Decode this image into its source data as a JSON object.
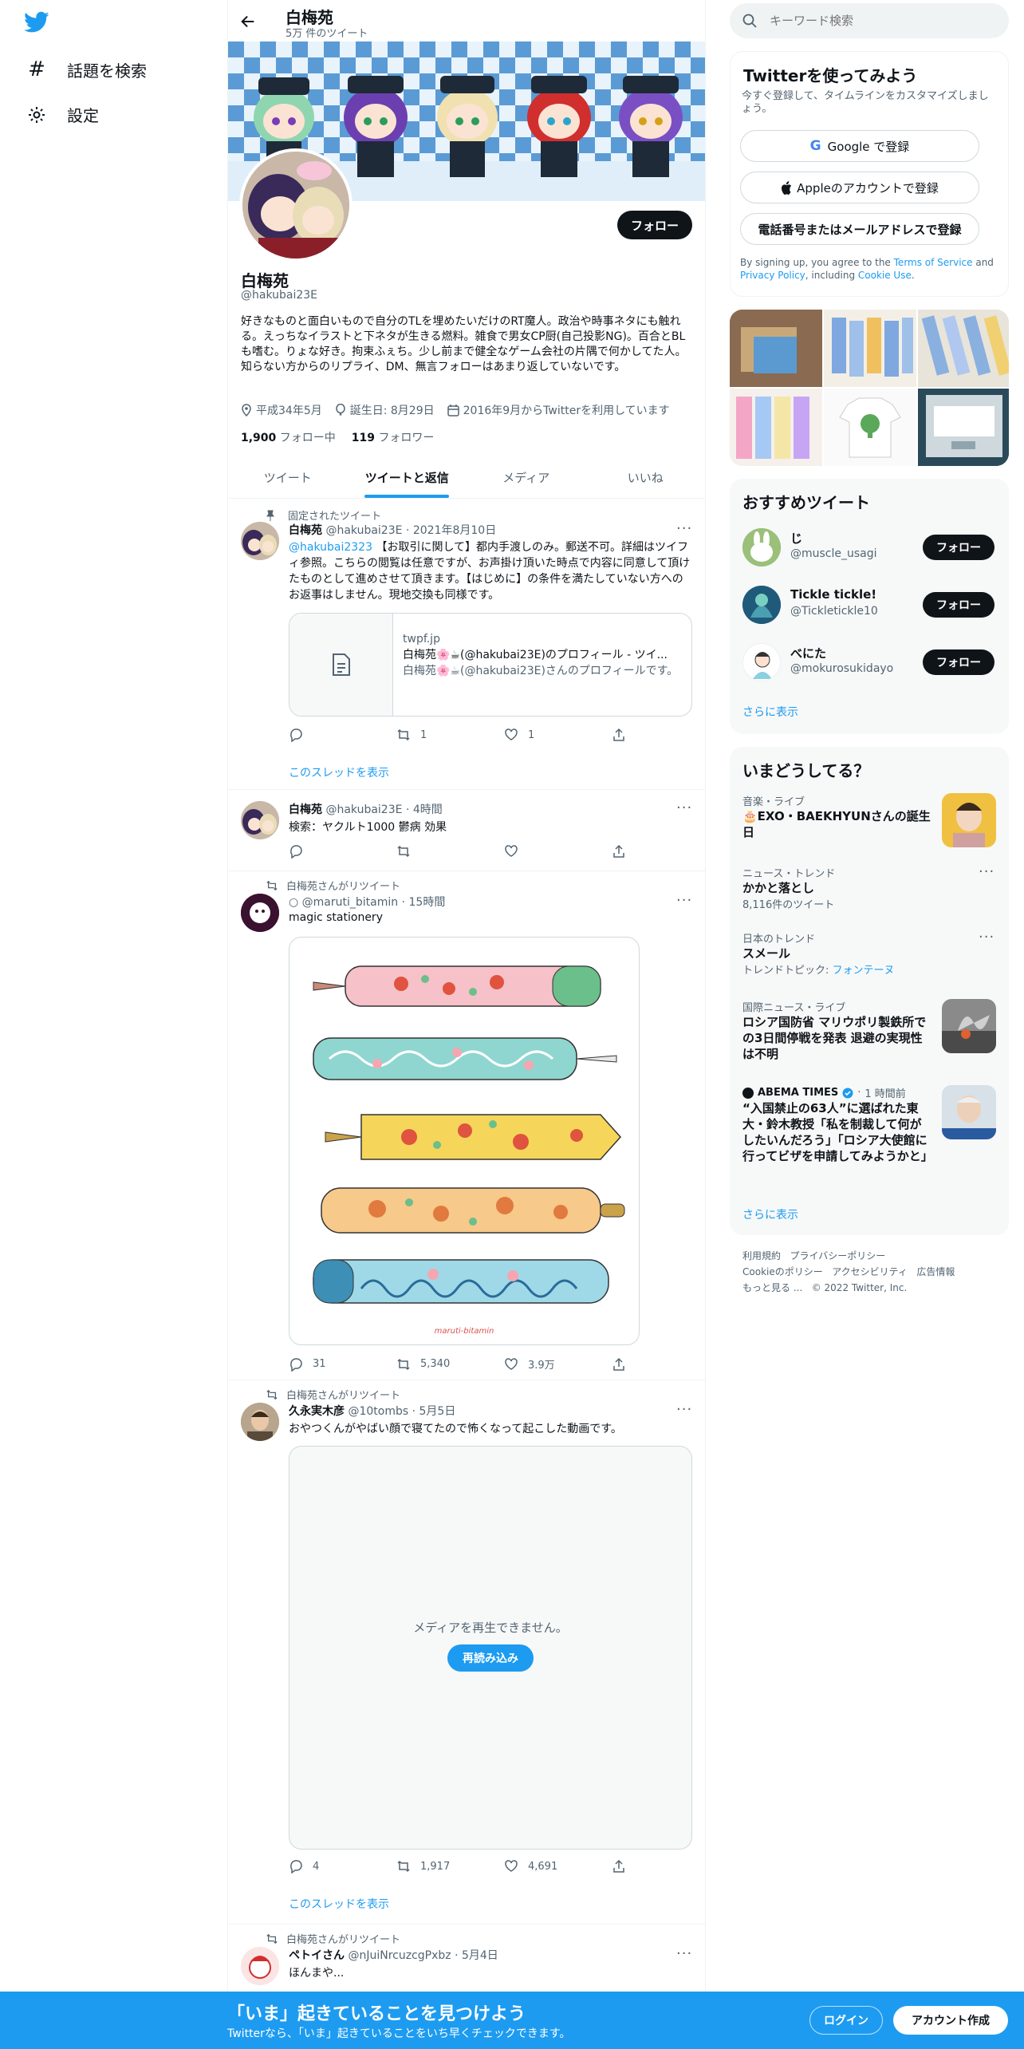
{
  "nav": {
    "explore_label": "話題を検索",
    "settings_label": "設定"
  },
  "header": {
    "name": "白梅苑",
    "tweet_count": "5万 件のツイート"
  },
  "profile": {
    "name": "白梅苑",
    "handle": "@hakubai23E",
    "follow_label": "フォロー",
    "bio": "好きなものと面白いもので自分のTLを埋めたいだけのRT魔人。政治や時事ネタにも触れる。えっちなイラストと下ネタが生きる燃料。雑食で男女CP厨(自己投影NG)。百合とBLも嗜む。りょな好き。拘束ふぇち。少し前まで健全なゲーム会社の片隅で何かしてた人。知らない方からのリプライ、DM、無言フォローはあまり返していないです。",
    "location": "平成34年5月",
    "birthday": "誕生日: 8月29日",
    "joined": "2016年9月からTwitterを利用しています",
    "following_count": "1,900",
    "following_label": "フォロー中",
    "followers_count": "119",
    "followers_label": "フォロワー"
  },
  "tabs": [
    {
      "label": "ツイート",
      "active": false
    },
    {
      "label": "ツイートと返信",
      "active": true
    },
    {
      "label": "メディア",
      "active": false
    },
    {
      "label": "いいね",
      "active": false
    }
  ],
  "tweets": [
    {
      "pinned_label": "固定されたツイート",
      "name": "白梅苑",
      "handle": "@hakubai23E",
      "time": "2021年8月10日",
      "mention": "@hakubai2323",
      "text": "【お取引に関して】都内手渡しのみ。郵送不可。詳細はツイフィ参照。こちらの閲覧は任意ですが、お声掛け頂いた時点で内容に同意して頂けたものとして進めさせて頂きます。【はじめに】の条件を満たしていない方へのお返事はしません。現地交換も同様です。",
      "card_domain": "twpf.jp",
      "card_title": "白梅苑🌸☕(@hakubai23E)のプロフィール - ツイ...",
      "card_desc": "白梅苑🌸☕(@hakubai23E)さんのプロフィールです。",
      "retweets": "1",
      "likes": "1",
      "thread_label": "このスレッドを表示"
    },
    {
      "name": "白梅苑",
      "handle": "@hakubai23E",
      "time": "4時間",
      "text": "検索：ヤクルト1000 鬱病 効果"
    },
    {
      "retweet_label": "白梅苑さんがリツイート",
      "name": "",
      "handle": "○ @maruti_bitamin",
      "time": "15時間",
      "text": "magic stationery",
      "image_caption": "maruti-bitamin",
      "replies": "31",
      "retweets": "5,340",
      "likes": "3.9万"
    },
    {
      "retweet_label": "白梅苑さんがリツイート",
      "name": "久永実木彦",
      "handle": "@10tombs",
      "time": "5月5日",
      "text": "おやつくんがやばい顔で寝てたので怖くなって起こした動画です。",
      "media_error": "メディアを再生できません。",
      "reload_label": "再読み込み",
      "replies": "4",
      "retweets": "1,917",
      "likes": "4,691",
      "thread_label": "このスレッドを表示"
    },
    {
      "retweet_label": "白梅苑さんがリツイート",
      "name": "ペトイさん",
      "handle": "@nJuiNrcuzcgPxbz",
      "time": "5月4日",
      "text": "ほんまや..."
    }
  ],
  "search": {
    "placeholder": "キーワード検索"
  },
  "signup": {
    "title": "Twitterを使ってみよう",
    "subtitle": "今すぐ登録して、タイムラインをカスタマイズしましょう。",
    "google_label": "Google で登録",
    "apple_label": "Appleのアカウントで登録",
    "phone_label": "電話番号またはメールアドレスで登録",
    "terms_prefix": "By signing up, you agree to the ",
    "terms_link": "Terms of Service",
    "terms_and": " and ",
    "privacy_link": "Privacy Policy",
    "terms_including": ", including ",
    "cookie_link": "Cookie Use",
    "terms_end": "."
  },
  "who_to_follow": {
    "title": "おすすめツイート",
    "users": [
      {
        "name": "じ",
        "handle": "@muscle_usagi",
        "follow_label": "フォロー"
      },
      {
        "name": "Tickle tickle!",
        "handle": "@Tickletickle10",
        "follow_label": "フォロー"
      },
      {
        "name": "べにた",
        "handle": "@mokurosukidayo",
        "follow_label": "フォロー"
      }
    ],
    "show_more": "さらに表示"
  },
  "trends": {
    "title": "いまどうしてる？",
    "items": [
      {
        "category": "音楽・ライブ",
        "title": "🎂EXO・BAEKHYUNさんの誕生日"
      },
      {
        "category": "ニュース・トレンド",
        "title": "かかと落とし",
        "meta": "8,116件のツイート"
      },
      {
        "category": "日本のトレンド",
        "title": "スメール",
        "meta_prefix": "トレンドトピック: ",
        "meta_link": "フォンテーヌ"
      },
      {
        "category": "国際ニュース・ライブ",
        "title": "ロシア国防省 マリウポリ製鉄所での3日間停戦を発表 退避の実現性は不明"
      },
      {
        "source": "ABEMA TIMES",
        "time": "1 時間前",
        "title": "“入国禁止の63人”に選ばれた東大・鈴木教授「私を制裁して何がしたいんだろう」「ロシア大使館に行ってビザを申請してみようかと」"
      }
    ],
    "show_more": "さらに表示"
  },
  "footer": {
    "links": [
      "利用規約",
      "プライバシーポリシー",
      "Cookieのポリシー",
      "アクセシビリティ",
      "広告情報",
      "もっと見る ..."
    ],
    "copyright": "© 2022 Twitter, Inc."
  },
  "banner": {
    "title": "「いま」起きていることを見つけよう",
    "subtitle": "Twitterなら、「いま」起きていることをいち早くチェックできます。",
    "login_label": "ログイン",
    "signup_label": "アカウント作成"
  },
  "colors": {
    "accent": "#1d9bf0",
    "text": "#0f1419",
    "muted": "#536471"
  }
}
